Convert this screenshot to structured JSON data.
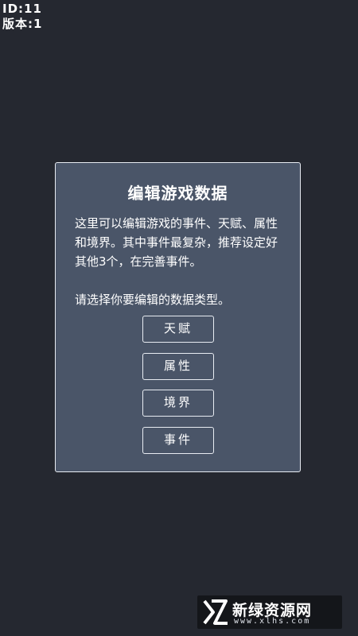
{
  "meta": {
    "id_label": "ID:11",
    "version_label": "版本:1"
  },
  "dialog": {
    "title": "编辑游戏数据",
    "description": "这里可以编辑游戏的事件、天赋、属性和境界。其中事件最复杂，推荐设定好其他3个，在完善事件。",
    "prompt": "请选择你要编辑的数据类型。",
    "buttons": [
      "天赋",
      "属性",
      "境界",
      "事件"
    ]
  },
  "watermark": {
    "name": "新绿资源网",
    "url": "www.xlhs.com"
  },
  "colors": {
    "background": "#252830",
    "panel": "#4a5568",
    "border": "#e8ecf2",
    "text": "#ffffff"
  }
}
